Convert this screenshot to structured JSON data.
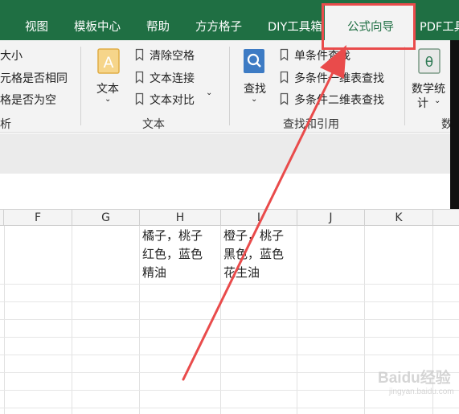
{
  "tabs": {
    "view": "视图",
    "template_center": "模板中心",
    "help": "帮助",
    "grid_tools": "方方格子",
    "diy_toolbox": "DIY工具箱",
    "formula_wizard": "公式向导",
    "pdf_tools": "PDF工具"
  },
  "ribbon": {
    "left_items": [
      "大小",
      "元格是否相同",
      "格是否为空"
    ],
    "left_group_label": "析",
    "text_button": "文本",
    "text_items": [
      "清除空格",
      "文本连接",
      "文本对比"
    ],
    "text_group_label": "文本",
    "lookup_button": "查找",
    "lookup_items": [
      "单条件查找",
      "多条件一维表查找",
      "多条件二维表查找"
    ],
    "lookup_group_label": "查找和引用",
    "math_button_line1": "数学统",
    "math_button_line2": "计",
    "math_group_label": "数"
  },
  "sheet": {
    "columns": [
      "F",
      "G",
      "H",
      "I",
      "J",
      "K"
    ],
    "cells": {
      "H": [
        "橘子，桃子",
        "红色，蓝色",
        "精油"
      ],
      "I": [
        "橙子，桃子",
        "黑色，蓝色",
        "花生油"
      ]
    }
  },
  "watermark": {
    "line1": "Baidu经验",
    "line2": "jingyan.baidu.com"
  },
  "colors": {
    "tab_bar": "#1f6f43",
    "ribbon_bg": "#f3f3f3",
    "annotation_red": "#e94b4b"
  }
}
